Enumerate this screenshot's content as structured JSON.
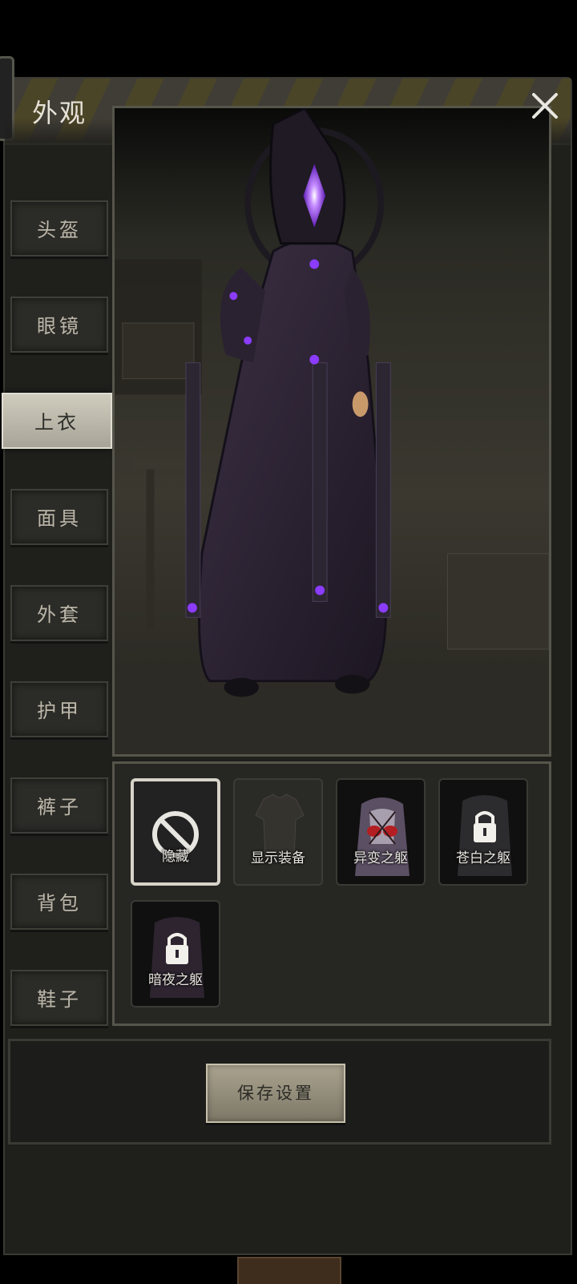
{
  "header": {
    "title": "外观"
  },
  "sidebar": {
    "items": [
      {
        "label": "头盔",
        "active": false
      },
      {
        "label": "眼镜",
        "active": false
      },
      {
        "label": "上衣",
        "active": true
      },
      {
        "label": "面具",
        "active": false
      },
      {
        "label": "外套",
        "active": false
      },
      {
        "label": "护甲",
        "active": false
      },
      {
        "label": "裤子",
        "active": false
      },
      {
        "label": "背包",
        "active": false
      },
      {
        "label": "鞋子",
        "active": false
      }
    ]
  },
  "items": [
    {
      "label": "隐藏",
      "selected": true,
      "locked": false,
      "icon": "forbidden-icon"
    },
    {
      "label": "显示装备",
      "selected": false,
      "locked": false,
      "icon": "shirt-icon"
    },
    {
      "label": "异变之躯",
      "selected": false,
      "locked": false,
      "icon": "body-icon"
    },
    {
      "label": "苍白之躯",
      "selected": false,
      "locked": true,
      "icon": "lock-icon"
    },
    {
      "label": "暗夜之躯",
      "selected": false,
      "locked": true,
      "icon": "lock-icon"
    }
  ],
  "footer": {
    "save_label": "保存设置"
  },
  "colors": {
    "accent_purple": "#8b3cff",
    "panel": "#1f1f1c",
    "button": "#a9a38f"
  }
}
